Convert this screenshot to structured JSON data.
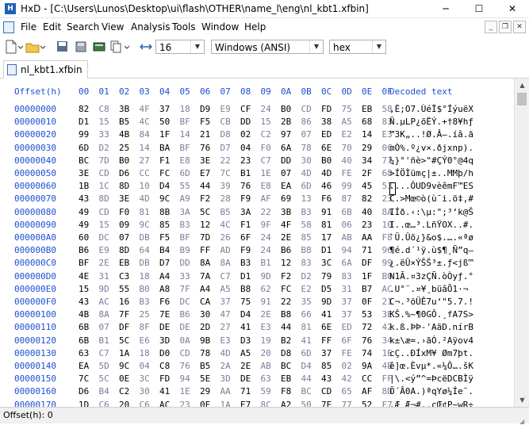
{
  "window": {
    "title": "HxD - [C:\\Users\\Lunos\\Desktop\\ui\\flash\\OTHER\\name_l\\eng\\nl_kbt1.xfbin]",
    "app_icon_label": "H",
    "minimize": "─",
    "maximize": "☐",
    "close": "✕"
  },
  "menu": [
    "File",
    "Edit",
    "Search",
    "View",
    "Analysis",
    "Tools",
    "Window",
    "Help"
  ],
  "mdi": {
    "minimize": "_",
    "restore": "❐",
    "close": "✕"
  },
  "toolbar": {
    "bytes_per_row": "16",
    "charset": "Windows (ANSI)",
    "display_mode": "hex"
  },
  "tab": {
    "label": "nl_kbt1.xfbin"
  },
  "header": {
    "offset_label": "Offset(h)",
    "columns": [
      "00",
      "01",
      "02",
      "03",
      "04",
      "05",
      "06",
      "07",
      "08",
      "09",
      "0A",
      "0B",
      "0C",
      "0D",
      "0E",
      "0F"
    ],
    "decoded_label": "Decoded text"
  },
  "rows": [
    {
      "offset": "00000000",
      "hex": "82 C8 3B 4F 37 18 D9 E9 CF 24 B0 CD FD 75 EB 58",
      "text": "‚È;O7.ÙéÏ$°ÍýuëX"
    },
    {
      "offset": "00000010",
      "hex": "D1 15 B5 4C 50 BF F5 CB DD 15 2B 86 38 A5 68 83",
      "text": "Ñ.µLP¿õËÝ.+†8¥hƒ"
    },
    {
      "offset": "00000020",
      "hex": "99 33 4B 84 1F 14 21 D8 02 C2 97 07 ED E2 14 E3",
      "text": "™3K„..!Ø.Â—.íâ.ã"
    },
    {
      "offset": "00000030",
      "hex": "6D D2 25 14 BA BF 76 D7 04 F0 6A 78 6E 70 29 0C",
      "text": "mÒ%.º¿v×.ðjxnp)."
    },
    {
      "offset": "00000040",
      "hex": "BC 7D B0 27 F1 E8 3E 22 23 C7 DD 30 B0 40 34 71",
      "text": "¼}°'ñè>\"#ÇÝ0°@4q"
    },
    {
      "offset": "00000050",
      "hex": "3E CD D6 CC FC 6D E7 7C B1 1E 07 4D 4D FE 2F 68",
      "text": ">ÍÖÌümç|±..MMþ/h"
    },
    {
      "offset": "00000060",
      "hex": "1B 1C 8D 10 D4 55 44 39 76 E8 EA 6D 46 99 45 53",
      "text": "....ÔUD9vèêmF™ES"
    },
    {
      "offset": "00000070",
      "hex": "43 8D 3E 4D 9C A9 F2 28 F9 AF 69 13 F6 87 82 23",
      "text": "C.>Mœ©ò(ù¯i.ö‡‚#"
    },
    {
      "offset": "00000080",
      "hex": "49 CD F0 81 8B 3A 5C B5 3A 22 3B B3 91 6B 40 8A",
      "text": "IÍð.‹:\\µ:\";³‘k@Š"
    },
    {
      "offset": "00000090",
      "hex": "49 15 09 9C 85 B3 12 4C F1 9F 4F 58 81 06 23 10",
      "text": "I..œ…³.LñŸOX..#."
    },
    {
      "offset": "000000A0",
      "hex": "60 DC 07 DB F5 BF 7D 26 6F 24 2E 85 17 AB AA F8",
      "text": "`Ü.Ûõ¿}&o$.….«ªø"
    },
    {
      "offset": "000000B0",
      "hex": "B6 E9 8D 64 B4 B9 FF AD F9 24 B6 B8 D1 94 71 96",
      "text": "¶é.d´¹ÿ.ù$¶¸Ñ”q–"
    },
    {
      "offset": "000000C0",
      "hex": "BF 2E EB DB D7 DD 8A 8A B3 B1 12 83 3C 6A DF 99",
      "text": "¿.ëÛ×ÝŠŠ³±.ƒ<jß™"
    },
    {
      "offset": "000000D0",
      "hex": "4E 31 C3 18 A4 33 7A C7 D1 9D F2 D2 79 83 1F B0",
      "text": "N1Ã.¤3zÇÑ.òÒyƒ.°"
    },
    {
      "offset": "000000E0",
      "hex": "15 9D 55 B0 A8 7F A4 A5 B8 62 FC E2 D5 31 B7 AC",
      "text": ".U°¨.¤¥¸büâÕ1·¬"
    },
    {
      "offset": "000000F0",
      "hex": "43 AC 16 B3 F6 DC CA 37 75 91 22 35 9D 37 0F 21",
      "text": "C¬.³öÜÊ7u‘\"5.7.!"
    },
    {
      "offset": "00000100",
      "hex": "4B 8A 7F 25 7E B6 30 47 D4 2E B8 66 41 37 53 3E",
      "text": "KŠ.%~¶0GÔ.¸fA7S>"
    },
    {
      "offset": "00000110",
      "hex": "6B 07 DF 8F DE DE 2D 27 41 E3 44 81 6E ED 72 42",
      "text": "k.ß.ÞÞ-'AãD.nírB"
    },
    {
      "offset": "00000120",
      "hex": "6B B1 5C E6 3D 0A 9B E3 D3 19 B2 41 FF 6F 76 34",
      "text": "k±\\æ=.›ãÓ.²Aÿov4"
    },
    {
      "offset": "00000130",
      "hex": "63 C7 1A 18 D0 CD 78 4D A5 20 D8 6D 37 FE 74 1E",
      "text": "cÇ..ÐÍxM¥ Øm7þt."
    },
    {
      "offset": "00000140",
      "hex": "EA 5D 9C 04 C8 76 B5 2A 2E AB BC D4 85 02 9A 4B",
      "text": "ê]œ.Èvµ*.«¼Ô….šK"
    },
    {
      "offset": "00000150",
      "hex": "7C 5C 0E 3C FD 94 5E 3D DE 63 EB 44 43 42 CC FF",
      "text": "|\\.<ý”^=ÞcëDCBÌÿ"
    },
    {
      "offset": "00000160",
      "hex": "D6 B4 C2 30 41 1E 29 AA 71 59 F8 BC CD 65 AF 8D",
      "text": "Ö´Â0A.)ªqYø¼Íe¯."
    },
    {
      "offset": "00000170",
      "hex": "1D C6 20 C6 AC 23 0E 1A E7 8C A2 50 7E 77 52 F7",
      "text": ".Æ Æ¬#..çŒ¢P~wR÷"
    }
  ],
  "status": {
    "offset": "Offset(h): 0"
  },
  "colors": {
    "accent": "#1c4fd4",
    "odd_column": "#7c7c9c",
    "even_column": "#000000"
  }
}
